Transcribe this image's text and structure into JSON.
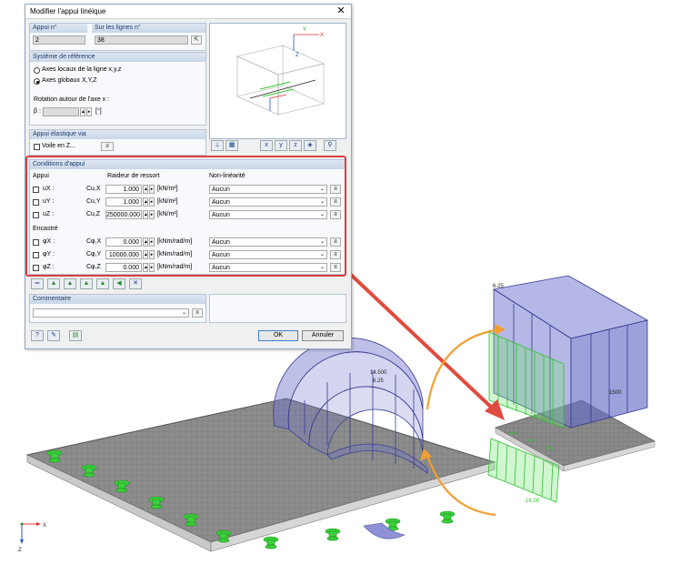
{
  "dialog": {
    "title": "Modifier l'appui linéique",
    "close": "✕"
  },
  "support": {
    "no_label": "Appui n°",
    "no_value": "2",
    "lines_label": "Sur les lignes n°",
    "lines_value": "38"
  },
  "reference": {
    "title": "Système de référence",
    "option_local": "Axes locaux de la ligne x,y,z",
    "option_global": "Axes globaux X,Y,Z",
    "selected": "global",
    "rotation_label": "Rotation autour de l'axe x :",
    "beta_label": "β :",
    "beta_value": "",
    "beta_unit": "[°]"
  },
  "elastic": {
    "title": "Appui élastique via",
    "wall_label": "Voile en Z..."
  },
  "conditions": {
    "title": "Conditions d'appui",
    "col_support": "Appui",
    "col_stiffness": "Raideur de ressort",
    "col_nonlinear": "Non-linéarité",
    "fixed_label": "Encastré",
    "translations": [
      {
        "dof": "uX :",
        "sym": "Cu,X",
        "value": "1.000",
        "unit": "[kN/m²]",
        "nl": "Aucun"
      },
      {
        "dof": "uY :",
        "sym": "Cu,Y",
        "value": "1.000",
        "unit": "[kN/m²]",
        "nl": "Aucun"
      },
      {
        "dof": "uZ :",
        "sym": "Cu,Z",
        "value": "250000.000",
        "unit": "[kN/m²]",
        "nl": "Aucun"
      }
    ],
    "rotations": [
      {
        "dof": "φX :",
        "sym": "Cφ,X",
        "value": "0.000",
        "unit": "[kNm/rad/m]",
        "nl": "Aucun"
      },
      {
        "dof": "φY :",
        "sym": "Cφ,Y",
        "value": "10000.000",
        "unit": "[kNm/rad/m]",
        "nl": "Aucun"
      },
      {
        "dof": "φZ :",
        "sym": "Cφ,Z",
        "value": "0.000",
        "unit": "[kNm/rad/m]",
        "nl": "Aucun"
      }
    ]
  },
  "comment": {
    "title": "Commentaire",
    "value": ""
  },
  "buttons": {
    "ok": "OK",
    "cancel": "Annuler"
  },
  "scene": {
    "label_left": "14.500",
    "label_left2": "6.25",
    "label_right_top": "6.25",
    "label_right_mid": "1500",
    "label_bottom": "16.00",
    "axis_x": "X",
    "axis_z": "Z",
    "preview_axis_x": "X",
    "preview_axis_y": "Y",
    "preview_axis_z": "Z"
  },
  "colors": {
    "highlight_box": "#d94040",
    "arrow_red": "#e04b3f",
    "arrow_orange": "#f0a030",
    "support_green": "#33cc33",
    "load_blue": "#6f72c6",
    "slab_grey": "#8a8a8a"
  }
}
